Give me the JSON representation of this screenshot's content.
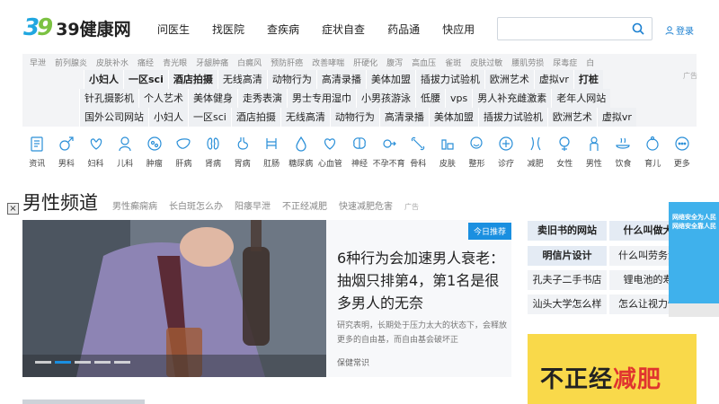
{
  "logo": {
    "mark_a": "3",
    "mark_b": "9",
    "text": "39健康网"
  },
  "nav": [
    "问医生",
    "找医院",
    "查疾病",
    "症状自查",
    "药品通",
    "快应用"
  ],
  "login": "登录",
  "tags1": [
    "早泄",
    "前列腺炎",
    "皮肤补水",
    "痛经",
    "青光眼",
    "牙龈肿痛",
    "白癜风",
    "预防肝癌",
    "改善哮喘",
    "肝硬化",
    "腹泻",
    "高血压",
    "雀斑",
    "皮肤过敏",
    "腰肌劳损",
    "尿毒症",
    "白"
  ],
  "ad_label": "广告",
  "ad_rows": [
    [
      {
        "t": "小妇人",
        "b": true
      },
      {
        "t": "一区sci",
        "b": true
      },
      {
        "t": "酒店拍摄",
        "b": true
      },
      {
        "t": "无线高清"
      },
      {
        "t": "动物行为"
      },
      {
        "t": "高清录播"
      },
      {
        "t": "美体加盟"
      },
      {
        "t": "插拔力试验机"
      },
      {
        "t": "欧洲艺术"
      },
      {
        "t": "虚拟vr"
      },
      {
        "t": "打桩",
        "b": true
      }
    ],
    [
      {
        "t": "针孔摄影机"
      },
      {
        "t": "个人艺术"
      },
      {
        "t": "美体健身"
      },
      {
        "t": "走秀表演"
      },
      {
        "t": "男士专用湿巾"
      },
      {
        "t": "小男孩游泳"
      },
      {
        "t": "低腰"
      },
      {
        "t": "vps"
      },
      {
        "t": "男人补充雌激素"
      },
      {
        "t": "老年人网站"
      }
    ],
    [
      {
        "t": "国外公司网站"
      },
      {
        "t": "小妇人"
      },
      {
        "t": "一区sci"
      },
      {
        "t": "酒店拍摄"
      },
      {
        "t": "无线高清"
      },
      {
        "t": "动物行为"
      },
      {
        "t": "高清录播"
      },
      {
        "t": "美体加盟"
      },
      {
        "t": "插拔力试验机"
      },
      {
        "t": "欧洲艺术"
      },
      {
        "t": "虚拟vr"
      }
    ]
  ],
  "cats": [
    {
      "label": "资讯",
      "icon": "news-icon"
    },
    {
      "label": "男科",
      "icon": "male-icon"
    },
    {
      "label": "妇科",
      "icon": "uterus-icon"
    },
    {
      "label": "儿科",
      "icon": "child-icon"
    },
    {
      "label": "肿瘤",
      "icon": "tumor-icon"
    },
    {
      "label": "肝病",
      "icon": "liver-icon"
    },
    {
      "label": "肾病",
      "icon": "kidney-icon"
    },
    {
      "label": "胃病",
      "icon": "stomach-icon"
    },
    {
      "label": "肛肠",
      "icon": "intestine-icon"
    },
    {
      "label": "糖尿病",
      "icon": "drop-icon"
    },
    {
      "label": "心血管",
      "icon": "heart-icon"
    },
    {
      "label": "神经",
      "icon": "brain-icon"
    },
    {
      "label": "不孕不育",
      "icon": "fertility-icon"
    },
    {
      "label": "骨科",
      "icon": "bone-icon"
    },
    {
      "label": "皮肤",
      "icon": "skin-icon"
    },
    {
      "label": "整形",
      "icon": "face-icon"
    },
    {
      "label": "诊疗",
      "icon": "cross-icon"
    },
    {
      "label": "减肥",
      "icon": "waist-icon"
    },
    {
      "label": "女性",
      "icon": "female-icon"
    },
    {
      "label": "男性",
      "icon": "man-icon"
    },
    {
      "label": "饮食",
      "icon": "food-icon"
    },
    {
      "label": "育儿",
      "icon": "baby-icon"
    },
    {
      "label": "更多",
      "icon": "more-icon"
    }
  ],
  "channel": {
    "title": "男性频道",
    "links": [
      "男性癫痫病",
      "长白斑怎么办",
      "阳痿早泄",
      "不正经减肥",
      "快速减肥危害"
    ],
    "ad": "广告"
  },
  "feature": {
    "badge": "今日推荐",
    "title": "6种行为会加速男人衰老：抽烟只排第4，第1名是很多男人的无奈",
    "desc": "研究表明，长期处于压力太大的状态下，会释放更多的自由基，而自由基会破坏正",
    "tag": "保健常识"
  },
  "side": [
    {
      "t": "卖旧书的网站",
      "b": true
    },
    {
      "t": "什么叫做大学",
      "b": true
    },
    {
      "t": "明信片设计",
      "b": true
    },
    {
      "t": "什么叫劳务派遣"
    },
    {
      "t": "孔夫子二手书店"
    },
    {
      "t": "锂电池的寿命"
    },
    {
      "t": "汕头大学怎么样"
    },
    {
      "t": "怎么让视力恢复"
    }
  ],
  "banner": {
    "text_a": "不正经",
    "text_b": "减肥"
  },
  "float_ad": {
    "line1": "网络安全为人民",
    "line2": "网络安全靠人民"
  },
  "close": "×"
}
